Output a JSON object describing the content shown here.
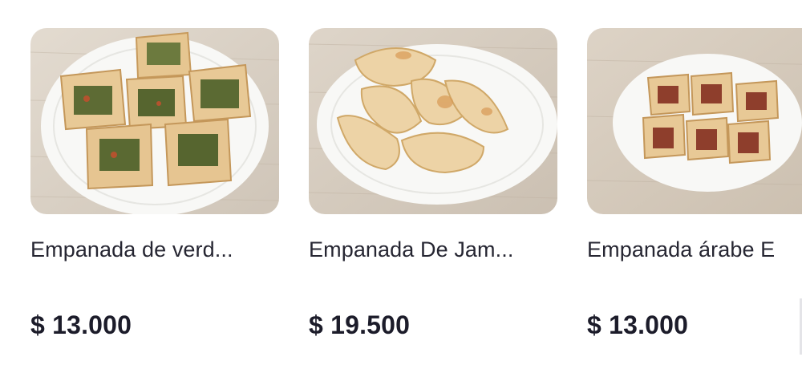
{
  "products": [
    {
      "name": "Empanada de verd...",
      "price": "$ 13.000",
      "image": "veggie-empanadas-photo"
    },
    {
      "name": "Empanada De Jam...",
      "price": "$ 19.500",
      "image": "ham-empanadas-photo"
    },
    {
      "name": "Empanada árabe E",
      "price": "$ 13.000",
      "image": "arabic-meat-empanadas-photo"
    }
  ],
  "colors": {
    "wood": "#d9d0c4",
    "plate": "#f7f7f5",
    "crust": "#e4c28e",
    "text": "#262632"
  }
}
